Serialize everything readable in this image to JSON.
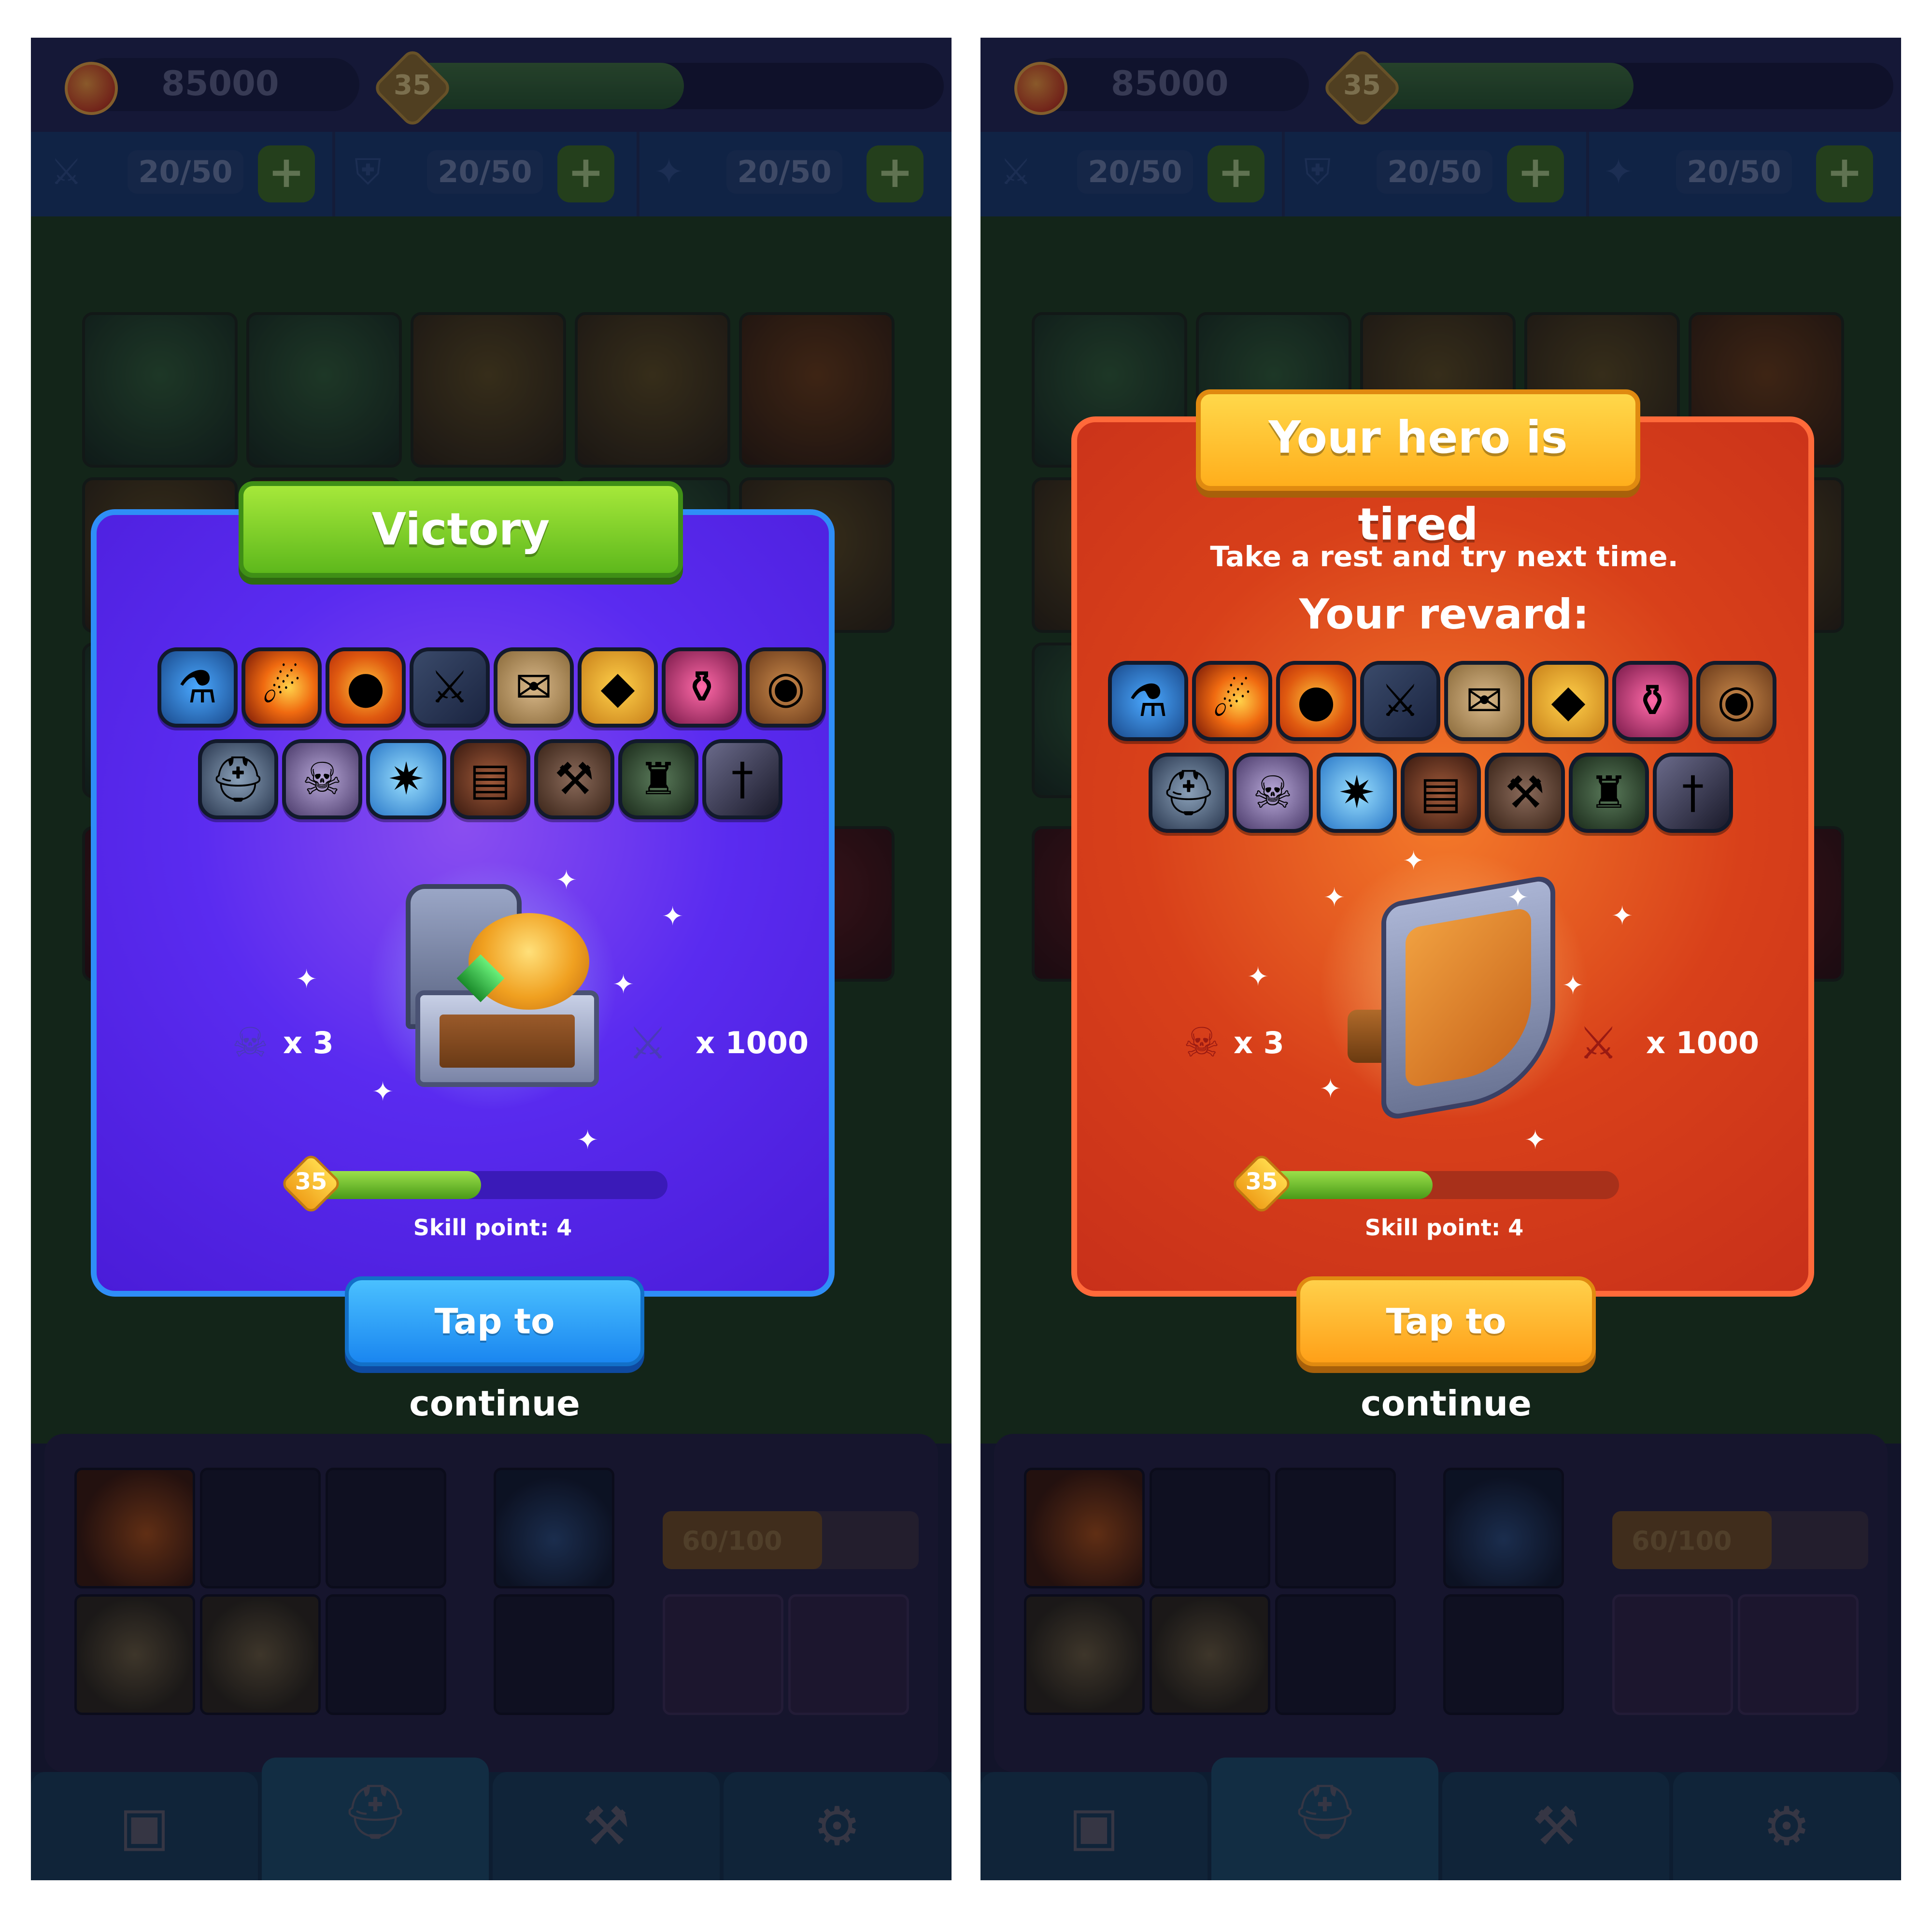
{
  "hud": {
    "coins": "85000",
    "level": "35",
    "stats": [
      "20/50",
      "20/50",
      "20/50"
    ],
    "plus": "+"
  },
  "inventory": {
    "mana": "60/100"
  },
  "victory": {
    "title": "Victory",
    "skulls": "x 3",
    "kills": "x 1000",
    "level": "35",
    "skill": "Skill point: 4",
    "button": "Tap to continue",
    "progress": 0.48
  },
  "tired": {
    "title": "Your hero is tired",
    "subtitle": "Take a rest and try next time.",
    "reward_heading": "Your revard:",
    "skulls": "x 3",
    "kills": "x 1000",
    "level": "35",
    "skill": "Skill point: 4",
    "button": "Tap to continue",
    "progress": 0.48
  },
  "reward_icons": [
    "potion",
    "fireball",
    "coin",
    "sword",
    "scroll",
    "ring",
    "pink-potion",
    "shield",
    "helmet",
    "skull-ring",
    "ice-orb",
    "armor",
    "axe",
    "viking-helmet",
    "dagger"
  ],
  "hud_xp_progress": 0.52,
  "colors": {
    "victory_panel": "#5a2bf0",
    "tired_panel": "#d8401a",
    "victory_ribbon": "#7ed02a",
    "tired_ribbon": "#ffc23a",
    "victory_button": "#1a86f0",
    "tired_button": "#ffa018"
  }
}
